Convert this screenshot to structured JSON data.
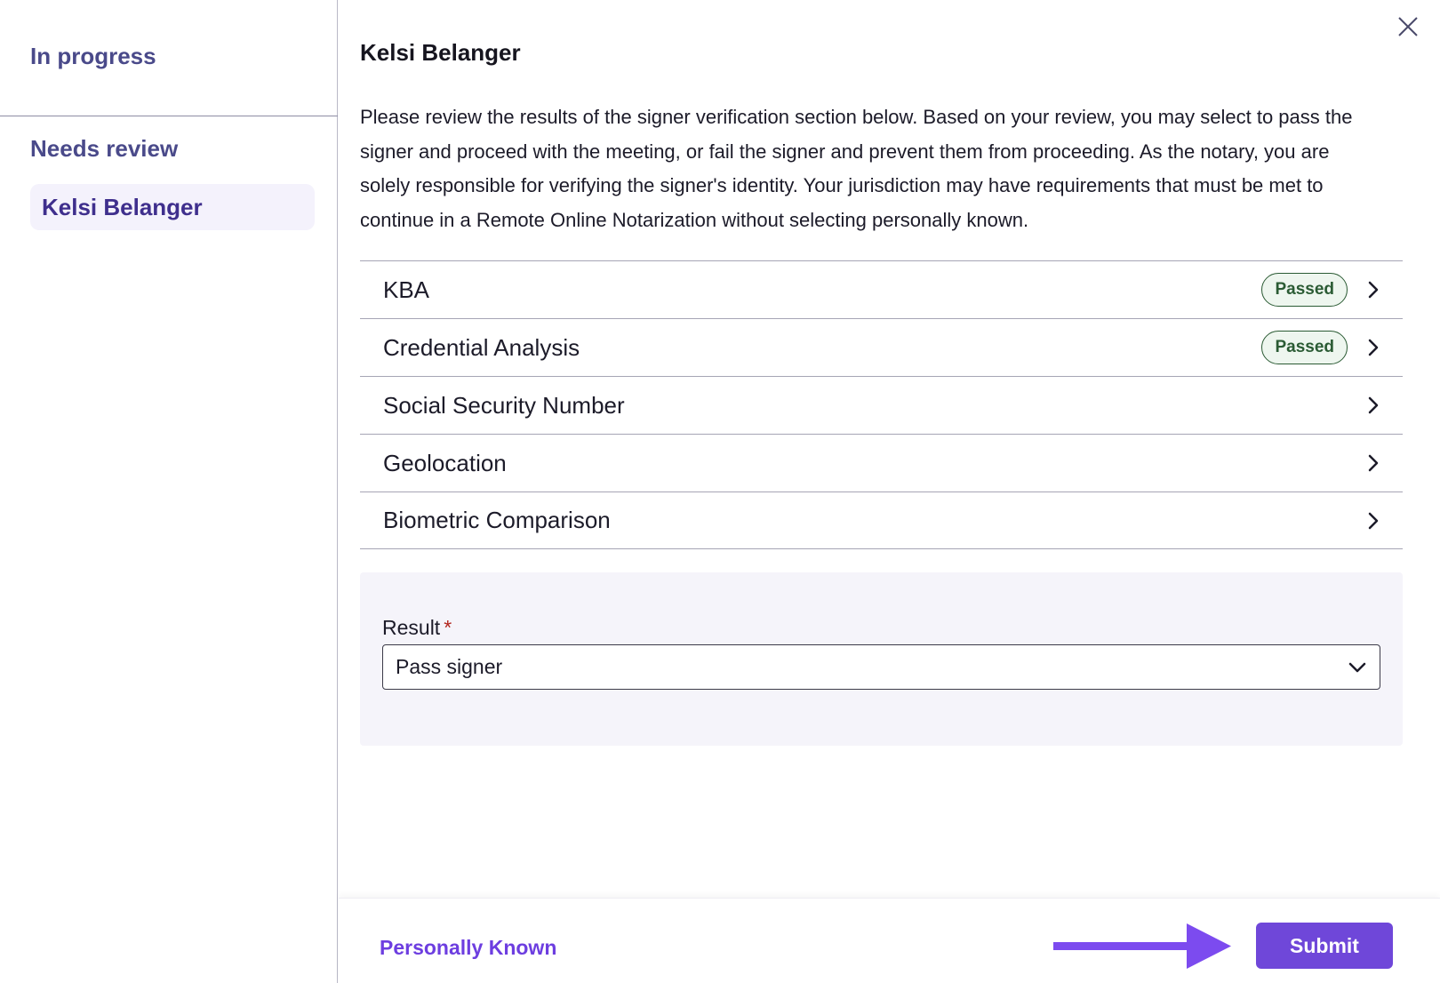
{
  "sidebar": {
    "in_progress_title": "In progress",
    "needs_review_title": "Needs review",
    "items": [
      {
        "label": "Kelsi Belanger",
        "selected": true
      }
    ]
  },
  "main": {
    "title": "Kelsi Belanger",
    "description": "Please review the results of the signer verification section below. Based on your review, you may select to pass the signer and proceed with the meeting, or fail the signer and prevent them from proceeding. As the notary, you are solely responsible for verifying the signer's identity. Your jurisdiction may have requirements that must be met to continue in a Remote Online Notarization without selecting personally known.",
    "checks": [
      {
        "label": "KBA",
        "status": "Passed"
      },
      {
        "label": "Credential Analysis",
        "status": "Passed"
      },
      {
        "label": "Social Security Number",
        "status": ""
      },
      {
        "label": "Geolocation",
        "status": ""
      },
      {
        "label": "Biometric Comparison",
        "status": ""
      }
    ],
    "result": {
      "label": "Result",
      "required_mark": "*",
      "selected_value": "Pass signer"
    }
  },
  "footer": {
    "personally_known_label": "Personally Known",
    "submit_label": "Submit"
  },
  "colors": {
    "accent": "#6f47d9",
    "passed": "#2b5b34",
    "sidebar_text": "#4a4a8a",
    "selected_bg": "#f4f2fc"
  },
  "icons": [
    "close-icon",
    "chevron-right-icon",
    "chevron-down-icon",
    "arrow-right-icon"
  ]
}
